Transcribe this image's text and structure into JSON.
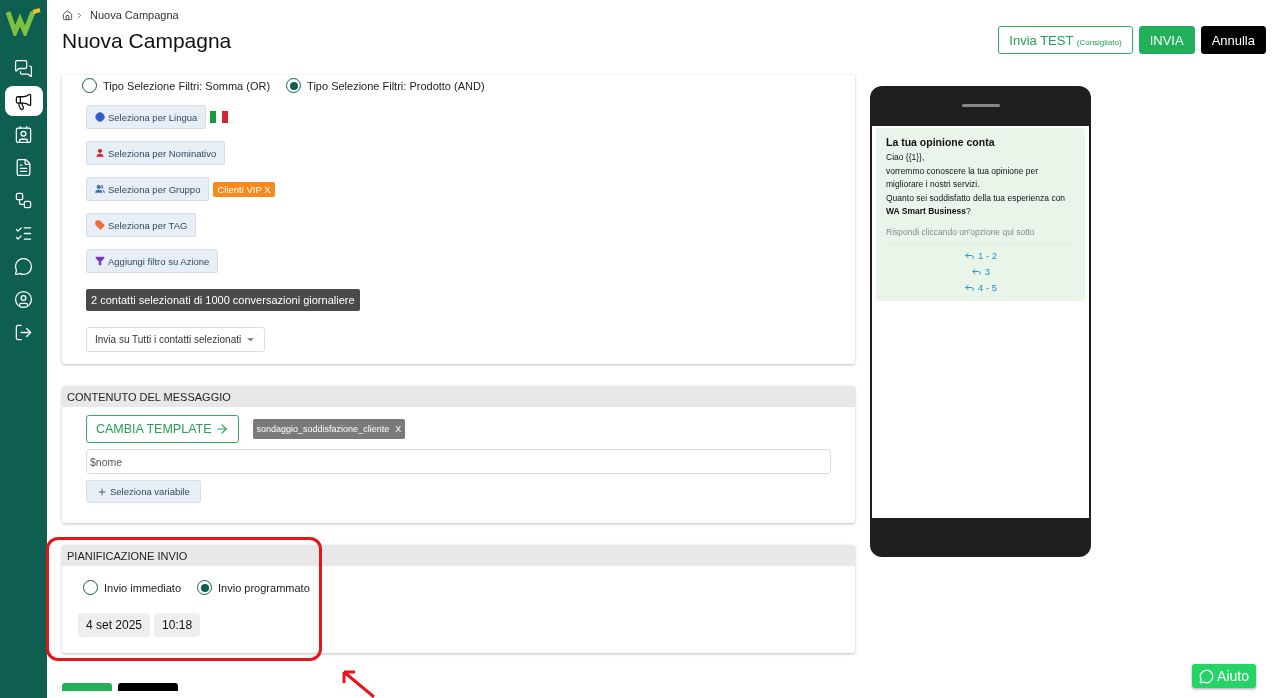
{
  "sidebar": {
    "items": [
      {
        "selected": false
      },
      {
        "selected": true
      },
      {
        "selected": false
      },
      {
        "selected": false
      },
      {
        "selected": false
      },
      {
        "selected": false
      },
      {
        "selected": false
      },
      {
        "selected": false
      },
      {
        "selected": false
      }
    ]
  },
  "breadcrumb": "Nuova Campagna",
  "title": "Nuova Campagna",
  "actions": {
    "test": {
      "label": "Invia TEST",
      "note": "(Consigliato)"
    },
    "send": "INVIA",
    "cancel": "Annulla"
  },
  "filters": {
    "modes": [
      {
        "label": "Tipo Selezione Filtri: Somma (OR)",
        "selected": false
      },
      {
        "label": "Tipo Selezione Filtri: Prodotto (AND)",
        "selected": true
      }
    ],
    "buttons": [
      {
        "kind": "language",
        "label": "Seleziona per Lingua",
        "attachment": {
          "kind": "flag"
        }
      },
      {
        "kind": "name",
        "label": "Seleziona per Nominativo"
      },
      {
        "kind": "group",
        "label": "Seleziona per Gruppo",
        "attachment": {
          "kind": "chip",
          "label": "Clienti VIP X"
        }
      },
      {
        "kind": "tag",
        "label": "Seleziona per TAG"
      },
      {
        "kind": "action",
        "label": "Aggiungi filtro su Azione"
      }
    ],
    "summary": "2 contatti selezionati di 1000 conversazioni giornaliere",
    "send_target": "Invia su Tutti i contatti selezionati"
  },
  "message_content": {
    "title": "CONTENUTO DEL MESSAGGIO",
    "change_template": "CAMBIA TEMPLATE",
    "template_chip": {
      "label": "sondaggio_soddisfazione_cliente",
      "remove": "X"
    },
    "variable_field": "$nome",
    "add_variable": "Seleziona variabile"
  },
  "schedule": {
    "title": "PIANIFICAZIONE INVIO",
    "options": [
      {
        "label": "Invio immediato",
        "selected": false
      },
      {
        "label": "Invio programmato",
        "selected": true
      }
    ],
    "date": "4 set 2025",
    "time": "10:18"
  },
  "preview": {
    "title": "La tua opinione conta",
    "body": "Ciao {{1}},\nvorremmo conoscere la tua opinione per migliorare i nostri servizi.\nQuanto sei soddisfatto della tua esperienza con **WA Smart Business**?",
    "footer": "Rispondi cliccando un'opzione qui sotto",
    "quick_replies": [
      "1 - 2",
      "3",
      "4 - 5"
    ]
  },
  "help": "Aiuto"
}
